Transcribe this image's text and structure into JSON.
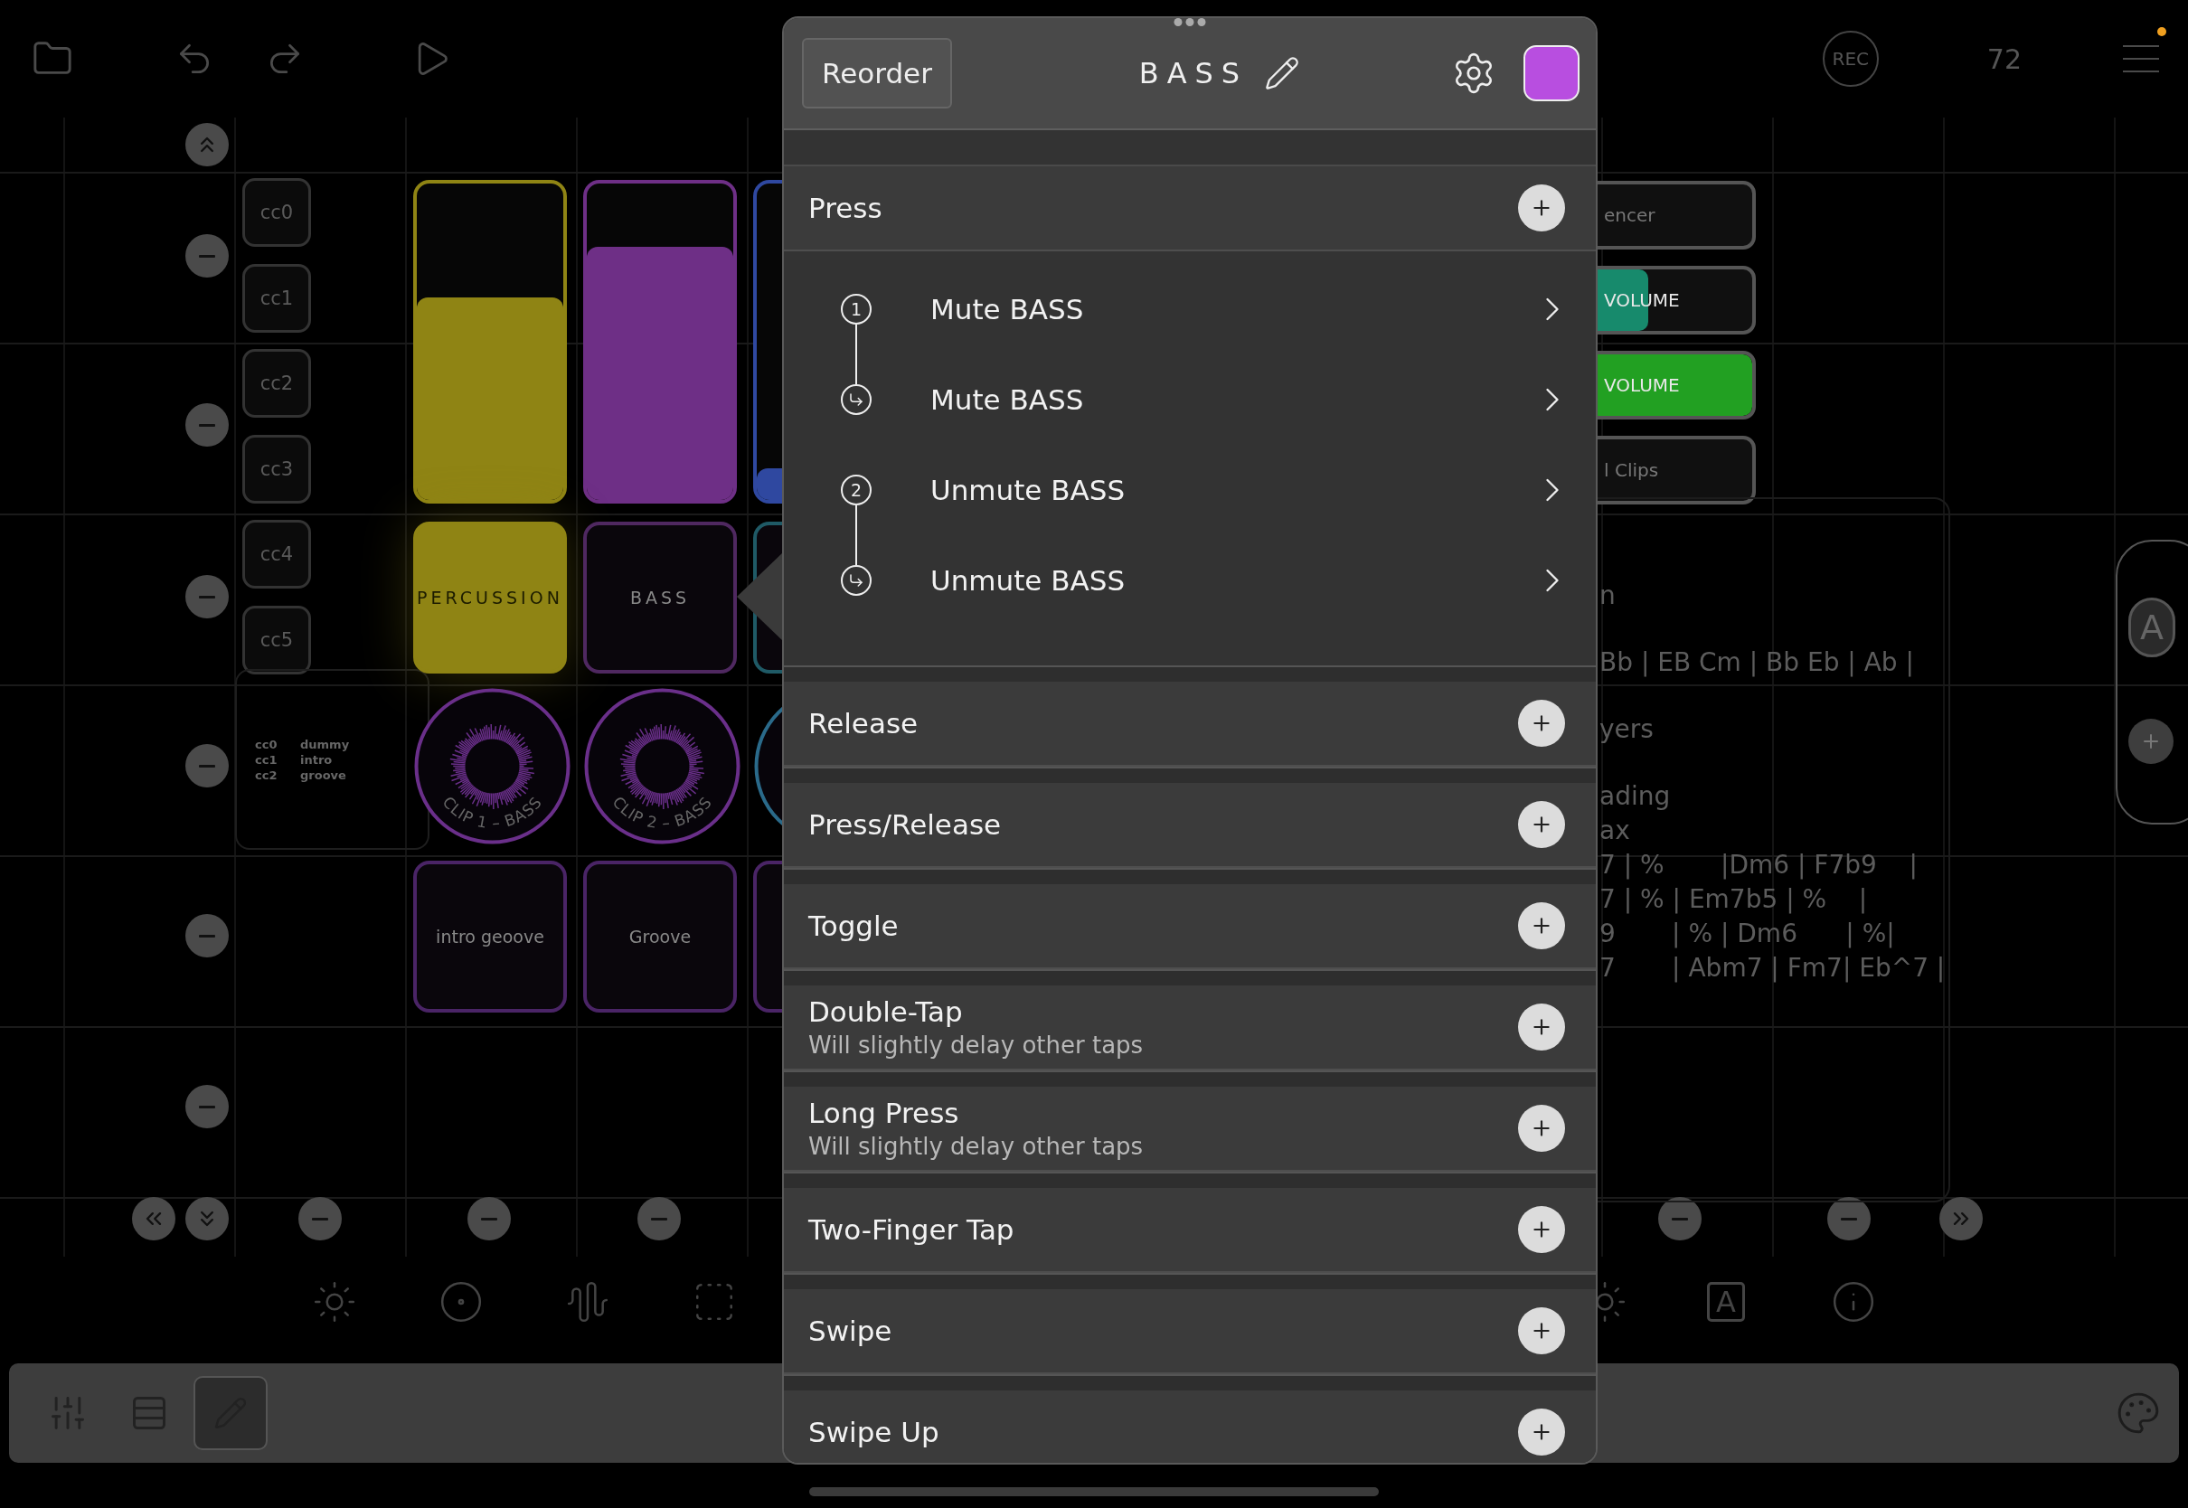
{
  "top_bar": {
    "rec": "REC",
    "tempo": "72",
    "notification": true
  },
  "canvas": {
    "cc_buttons": [
      "cc0",
      "cc1",
      "cc2",
      "cc3",
      "cc4",
      "cc5"
    ],
    "cc_legend": [
      {
        "cc": "cc0",
        "name": "dummy"
      },
      {
        "cc": "cc1",
        "name": "intro"
      },
      {
        "cc": "cc2",
        "name": "groove"
      }
    ],
    "faders": [
      {
        "color": "#8f8414",
        "level": 0.64
      },
      {
        "color": "#6e2f86",
        "level": 0.8
      },
      {
        "color": "#2f48a0",
        "level": 0.1
      }
    ],
    "pads": [
      {
        "label": "PERCUSSION",
        "color": "#8f8414",
        "lit": true
      },
      {
        "label": "BASS",
        "color": "#4f2860",
        "lit": false
      },
      {
        "color": "#1f5a66",
        "lit": false
      }
    ],
    "clips": [
      {
        "label": "CLIP 1 – BASS",
        "color": "#6a2f8a"
      },
      {
        "label": "CLIP 2 – BASS",
        "color": "#6a2f8a"
      },
      {
        "color": "#2a6a8a"
      }
    ],
    "scene_pads": [
      {
        "label": "intro geoove",
        "color": "#4a2466"
      },
      {
        "label": "Groove",
        "color": "#4a2466"
      },
      {
        "color": "#4a2466"
      }
    ],
    "side_widgets": [
      {
        "kind": "button",
        "label": "encer"
      },
      {
        "kind": "fader",
        "label": "VOLUME",
        "color": "#178a6c",
        "level": 0.53
      },
      {
        "kind": "fader",
        "label": "VOLUME",
        "color": "#22a022",
        "level": 1
      },
      {
        "kind": "button",
        "label": "l Clips"
      }
    ],
    "notes": [
      [
        "n"
      ],
      [
        "Bb | EB Cm | Bb Eb | Ab |"
      ],
      [
        "yers"
      ],
      [
        "ading",
        "ax",
        "7 | %       |Dm6 | F7b9    |",
        "7 | % | Em7b5 | %    |",
        "9       | % | Dm6      | %|",
        "7       | Abm7 | Fm7| Eb^7 |"
      ]
    ],
    "scene_selector": {
      "label": "A"
    }
  },
  "icon_row": {
    "text_label": "A"
  },
  "popover": {
    "reorder": "Reorder",
    "title": "BASS",
    "color": "#b84ee0",
    "sections": [
      {
        "title": "Press",
        "actions": [
          {
            "kind": "start",
            "step": "1",
            "label": "Mute BASS"
          },
          {
            "kind": "release",
            "label": "Mute BASS"
          },
          {
            "kind": "start",
            "step": "2",
            "label": "Unmute BASS"
          },
          {
            "kind": "release",
            "label": "Unmute BASS"
          }
        ]
      },
      {
        "title": "Release"
      },
      {
        "title": "Press/Release"
      },
      {
        "title": "Toggle"
      },
      {
        "title": "Double-Tap",
        "subtitle": "Will slightly delay other taps"
      },
      {
        "title": "Long Press",
        "subtitle": "Will slightly delay other taps"
      },
      {
        "title": "Two-Finger Tap"
      },
      {
        "title": "Swipe"
      },
      {
        "title": "Swipe Up"
      }
    ]
  },
  "bottom_toolbar": {
    "tools": [
      {
        "kind": "mixer",
        "selected": false
      },
      {
        "kind": "list",
        "selected": false
      },
      {
        "kind": "edit",
        "selected": true
      }
    ]
  }
}
